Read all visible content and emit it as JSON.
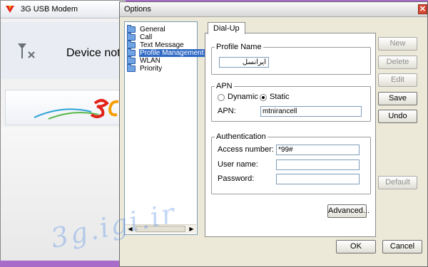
{
  "background_app": {
    "title": "3G USB Modem",
    "status_text": "Device not f"
  },
  "dialog": {
    "title": "Options",
    "close_glyph": "✕",
    "tree": {
      "items": [
        {
          "label": "General"
        },
        {
          "label": "Call"
        },
        {
          "label": "Text Message"
        },
        {
          "label": "Profile Management",
          "selected": true
        },
        {
          "label": "WLAN"
        },
        {
          "label": "Priority"
        }
      ],
      "scroll_left_glyph": "◀",
      "scroll_right_glyph": "▶"
    },
    "tab": {
      "label": "Dial-Up"
    },
    "profile_name": {
      "legend": "Profile Name",
      "value": "ایرانسل"
    },
    "apn": {
      "legend": "APN",
      "option_dynamic": "Dynamic",
      "option_static": "Static",
      "selected": "Static",
      "field_label": "APN:",
      "value": "mtnirancell"
    },
    "authentication": {
      "legend": "Authentication",
      "access_number_label": "Access number:",
      "access_number_value": "*99#",
      "username_label": "User name:",
      "username_value": "",
      "password_label": "Password:",
      "password_value": ""
    },
    "buttons": {
      "new": "New",
      "delete": "Delete",
      "edit": "Edit",
      "save": "Save",
      "undo": "Undo",
      "default": "Default",
      "advanced": "Advanced...",
      "ok": "OK",
      "cancel": "Cancel"
    }
  },
  "watermark": "3g.igi.ir",
  "colors": {
    "selection": "#316ac5",
    "dialog_bg": "#ece9d8",
    "frame": "#a86cc8"
  }
}
